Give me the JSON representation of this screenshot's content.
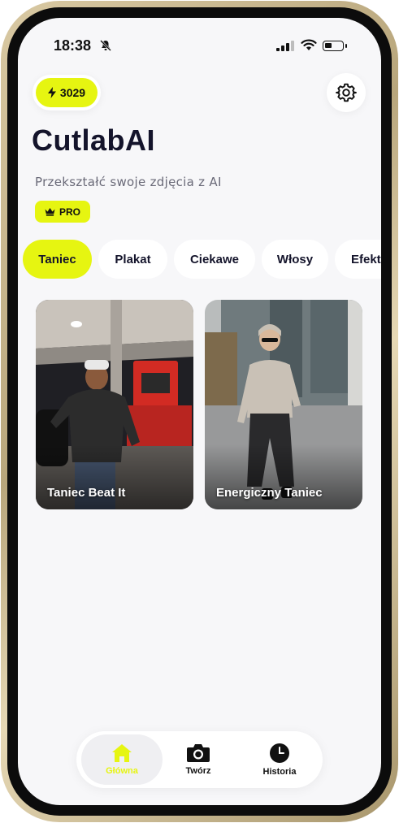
{
  "status_bar": {
    "time": "18:38"
  },
  "header": {
    "credits": "3029",
    "title": "CutlabAI",
    "subtitle": "Przekształć swoje zdjęcia z AI",
    "pro_label": "PRO"
  },
  "tabs": [
    {
      "label": "Taniec",
      "active": true
    },
    {
      "label": "Plakat",
      "active": false
    },
    {
      "label": "Ciekawe",
      "active": false
    },
    {
      "label": "Włosy",
      "active": false
    },
    {
      "label": "Efekt",
      "active": false
    }
  ],
  "cards": [
    {
      "label": "Taniec Beat It"
    },
    {
      "label": "Energiczny Taniec"
    }
  ],
  "bottom_nav": [
    {
      "label": "Główna",
      "icon": "home-icon",
      "active": true
    },
    {
      "label": "Twórz",
      "icon": "camera-icon",
      "active": false
    },
    {
      "label": "Historia",
      "icon": "clock-icon",
      "active": false
    }
  ],
  "colors": {
    "accent": "#e6f511",
    "text": "#14142b",
    "background": "#f7f7f9"
  }
}
